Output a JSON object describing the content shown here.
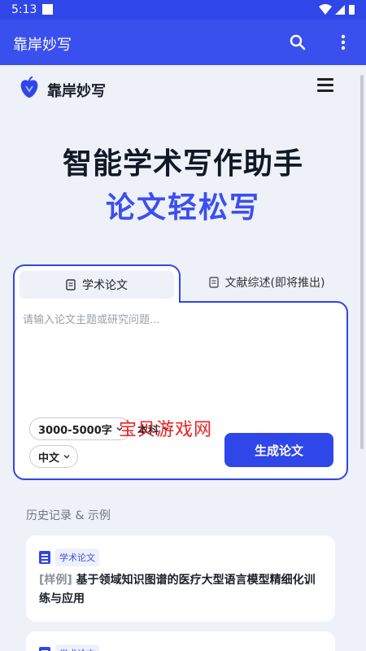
{
  "status": {
    "time": "5:13"
  },
  "appbar": {
    "title": "靠岸妙写"
  },
  "brand": {
    "name": "靠岸妙写"
  },
  "hero": {
    "line1": "智能学术写作助手",
    "line2": "论文轻松写"
  },
  "tabs": [
    {
      "label": "学术论文",
      "active": true
    },
    {
      "label": "文献综述(即将推出)",
      "active": false
    }
  ],
  "editor": {
    "placeholder": "请输入论文主题或研究问题...",
    "length": "3000-5000字",
    "level": "本科",
    "language": "中文",
    "generate": "生成论文"
  },
  "watermark": "宝贝游戏网",
  "history": {
    "label": "历史记录 & 示例",
    "items": [
      {
        "tag": "学术论文",
        "prefix": "[样例]",
        "title": "基于领域知识图谱的医疗大型语言模型精细化训练与应用"
      },
      {
        "tag": "学术论文"
      }
    ]
  },
  "colors": {
    "primary": "#2f46e8",
    "accent": "#3b4ff0",
    "background": "#eef1f8"
  }
}
